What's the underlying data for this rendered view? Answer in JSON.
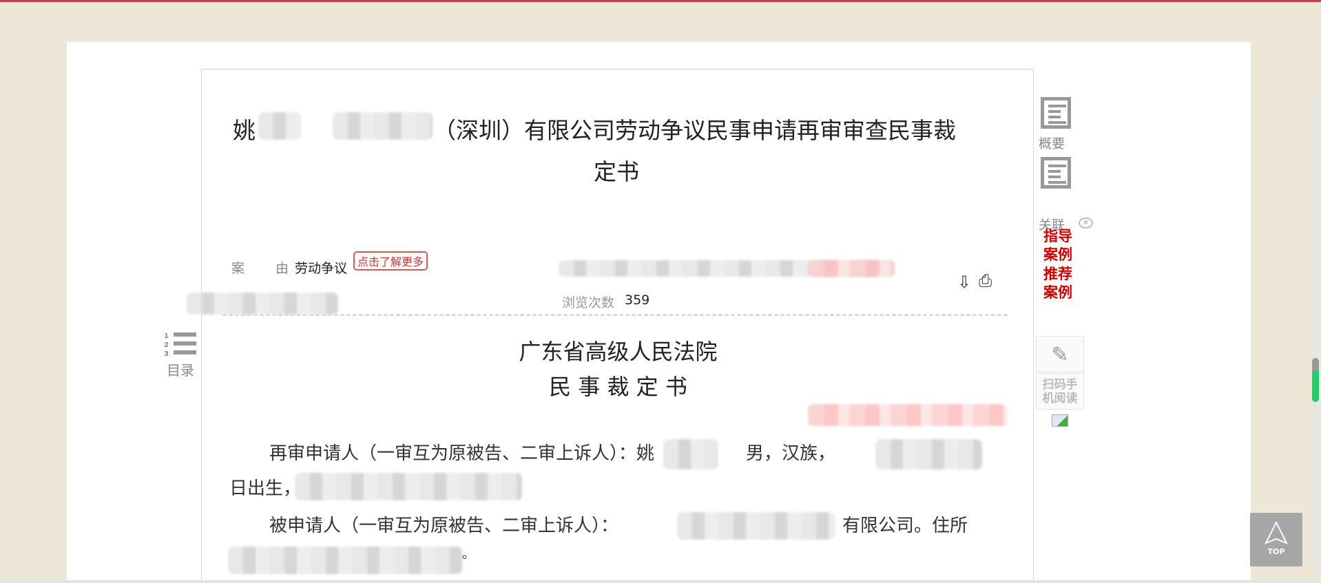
{
  "document": {
    "title_prefix": "姚",
    "title_suffix": "（深圳）有限公司劳动争议民事申请再审审查民事裁",
    "title_line2": "定书",
    "cause_label_1": "案",
    "cause_label_2": "由",
    "cause_value": "劳动争议",
    "learn_more_label": "点击了解更多",
    "views_label": "浏览次数",
    "views_count": "359",
    "court_name": "广东省高级人民法院",
    "doc_type": "民 事 裁 定 书",
    "para1_start": "再审申请人（一审互为原被告、二审上诉人）：姚",
    "para1_mid": "男，汉族，",
    "para1_line2": "日出生，",
    "para2_start": "被申请人（一审互为原被告、二审上诉人）：",
    "para2_end": "有限公司。住所",
    "para2_line2_end": "。"
  },
  "toc": {
    "label": "目录",
    "numbers": [
      "1",
      "2",
      "3"
    ]
  },
  "sidebar": {
    "summary_label": "概要",
    "related_label": "关联",
    "guide_cases": "指导案例",
    "recommended_cases": "推荐案例",
    "scan_label": "扫码手机阅读",
    "top_label": "TOP"
  },
  "colors": {
    "accent_red": "#cc0000",
    "background": "#ede7d7",
    "scroll_thumb": "#22cc66"
  }
}
